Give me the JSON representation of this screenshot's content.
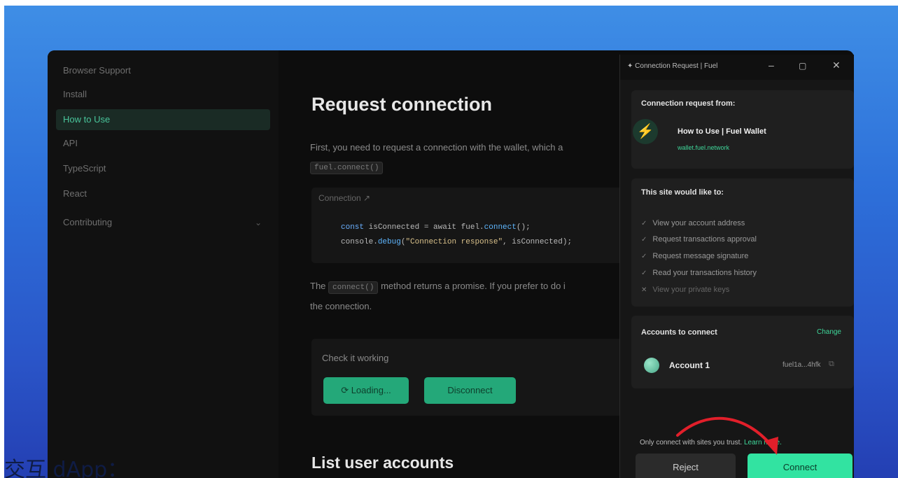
{
  "sidebar": {
    "items": [
      {
        "label": "Browser Support"
      },
      {
        "label": "Install"
      },
      {
        "label": "How to Use"
      },
      {
        "label": "API"
      },
      {
        "label": "TypeScript"
      },
      {
        "label": "React"
      },
      {
        "label": "Contributing"
      }
    ],
    "active_index": 2
  },
  "content": {
    "heading": "Request connection",
    "intro_text": "First, you need to request a connection with the wallet, which a",
    "intro_code": "fuel.connect()",
    "code": {
      "header": "Connection ↗",
      "line1_kw": "const",
      "line1_rest": " isConnected = await fuel.",
      "line1_fn": "connect",
      "line1_end": "();",
      "line2_start": "console.",
      "line2_fn": "debug",
      "line2_open": "(",
      "line2_str": "\"Connection response\"",
      "line2_end": ", isConnected);"
    },
    "method_text_before": "The",
    "method_code": "connect()",
    "method_text_after": "method returns a promise. If you prefer to do i",
    "method_text_line2": "the connection.",
    "demo": {
      "title": "Check it working",
      "loading_label": "⟳ Loading...",
      "disconnect_label": "Disconnect"
    },
    "heading2": "List user accounts"
  },
  "wallet": {
    "window_title": "Connection Request | Fuel",
    "connection_from_label": "Connection request from:",
    "app_name": "How to Use | Fuel Wallet",
    "app_url": "wallet.fuel.network",
    "site_would_like_label": "This site would like to:",
    "permissions": [
      {
        "label": "View your account address",
        "enabled": true
      },
      {
        "label": "Request transactions approval",
        "enabled": true
      },
      {
        "label": "Request message signature",
        "enabled": true
      },
      {
        "label": "Read your transactions history",
        "enabled": true
      },
      {
        "label": "View your private keys",
        "enabled": false
      }
    ],
    "accounts_label": "Accounts to connect",
    "change_label": "Change",
    "account_name": "Account 1",
    "account_addr": "fuel1a...4hfk",
    "only_connect_text": "Only connect with sites you trust.",
    "learn_more": "Learn more.",
    "reject_label": "Reject",
    "connect_label": "Connect"
  },
  "caption": "交互 dApp："
}
